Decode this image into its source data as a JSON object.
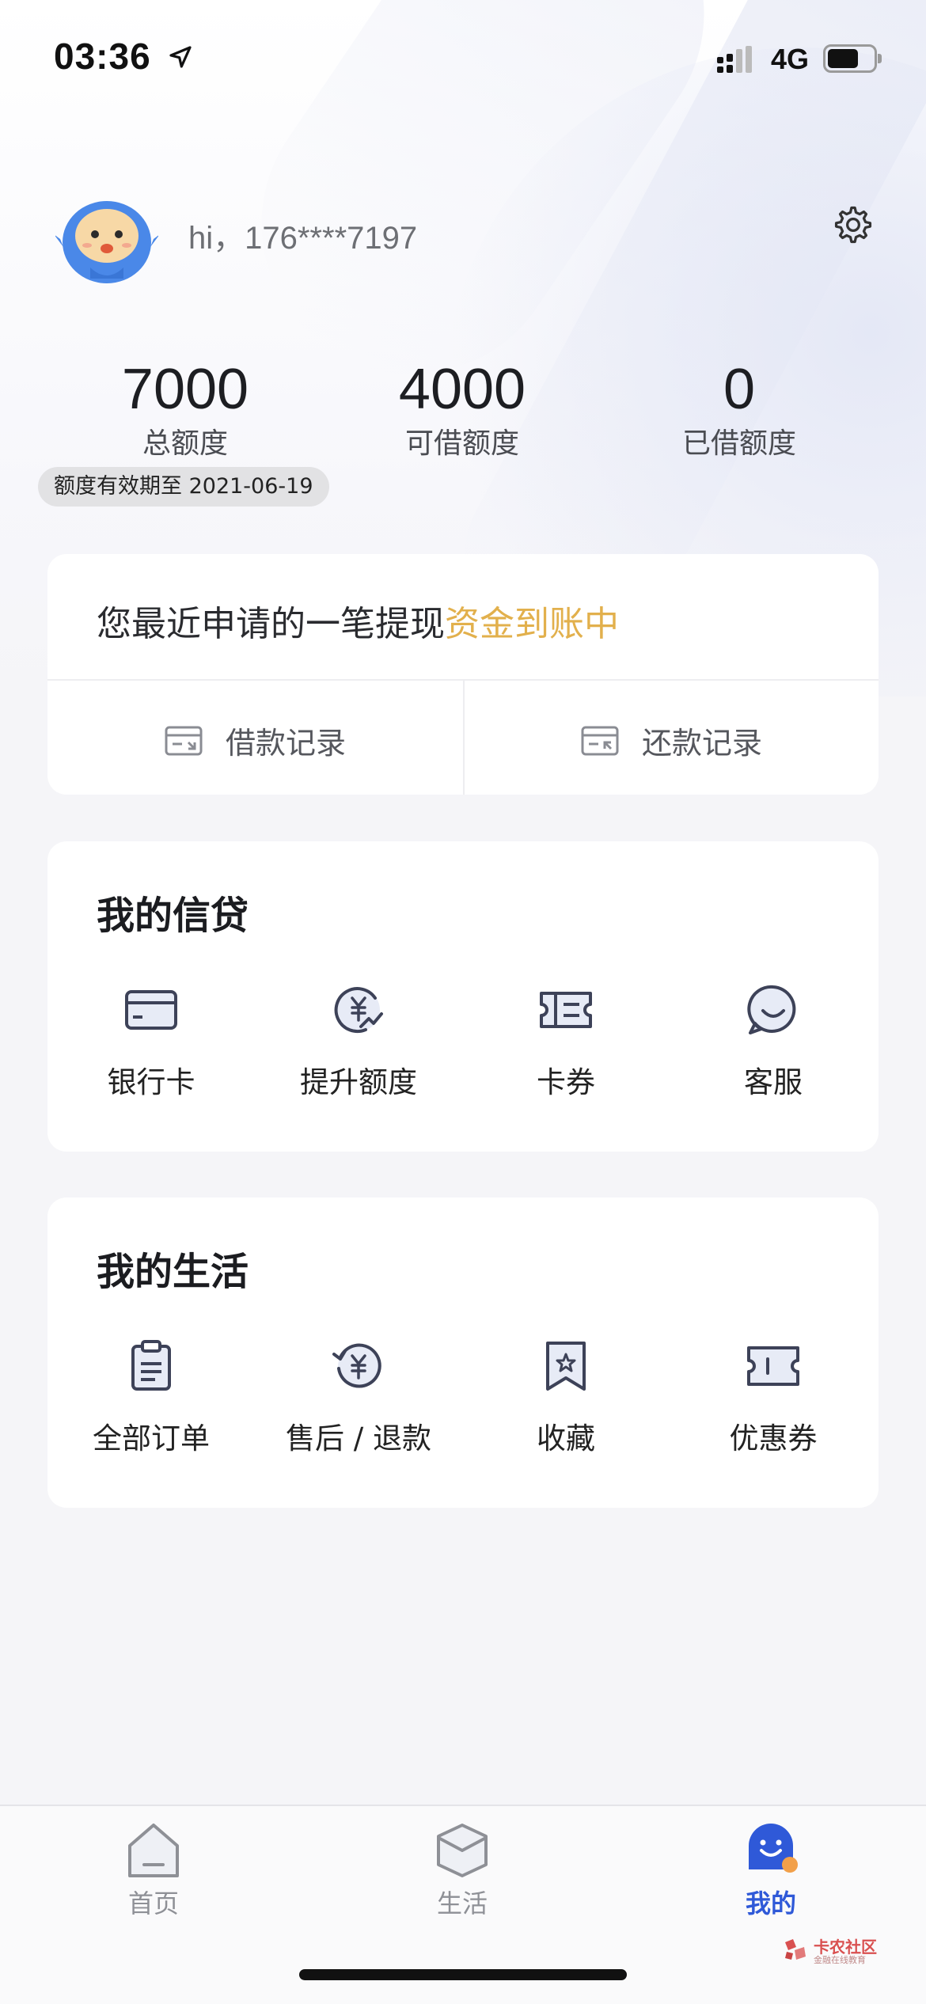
{
  "status_bar": {
    "time": "03:36",
    "network": "4G"
  },
  "profile": {
    "greeting": "hi，176****7197"
  },
  "credit": {
    "total_value": "7000",
    "total_label": "总额度",
    "available_value": "4000",
    "available_label": "可借额度",
    "borrowed_value": "0",
    "borrowed_label": "已借额度",
    "validity": "额度有效期至 2021-06-19"
  },
  "notice": {
    "text": "您最近申请的一笔提现",
    "highlight": "资金到账中",
    "highlight_color": "#e2b04c",
    "loan_records": "借款记录",
    "repay_records": "还款记录"
  },
  "my_credit": {
    "title": "我的信贷",
    "items": [
      {
        "label": "银行卡",
        "icon": "bank-card-icon"
      },
      {
        "label": "提升额度",
        "icon": "raise-limit-icon"
      },
      {
        "label": "卡券",
        "icon": "card-coupon-icon"
      },
      {
        "label": "客服",
        "icon": "customer-service-icon"
      }
    ]
  },
  "my_life": {
    "title": "我的生活",
    "items": [
      {
        "label": "全部订单",
        "icon": "orders-icon"
      },
      {
        "label": "售后 / 退款",
        "icon": "refund-icon"
      },
      {
        "label": "收藏",
        "icon": "favorites-icon"
      },
      {
        "label": "优惠券",
        "icon": "coupon-icon"
      }
    ]
  },
  "tab_bar": {
    "active_color": "#2f59d8",
    "tabs": [
      {
        "label": "首页",
        "icon": "home-icon"
      },
      {
        "label": "生活",
        "icon": "life-box-icon"
      },
      {
        "label": "我的",
        "icon": "mine-mascot-icon"
      }
    ]
  },
  "watermark": {
    "text": "卡农社区",
    "sub": "金融在线教育"
  }
}
